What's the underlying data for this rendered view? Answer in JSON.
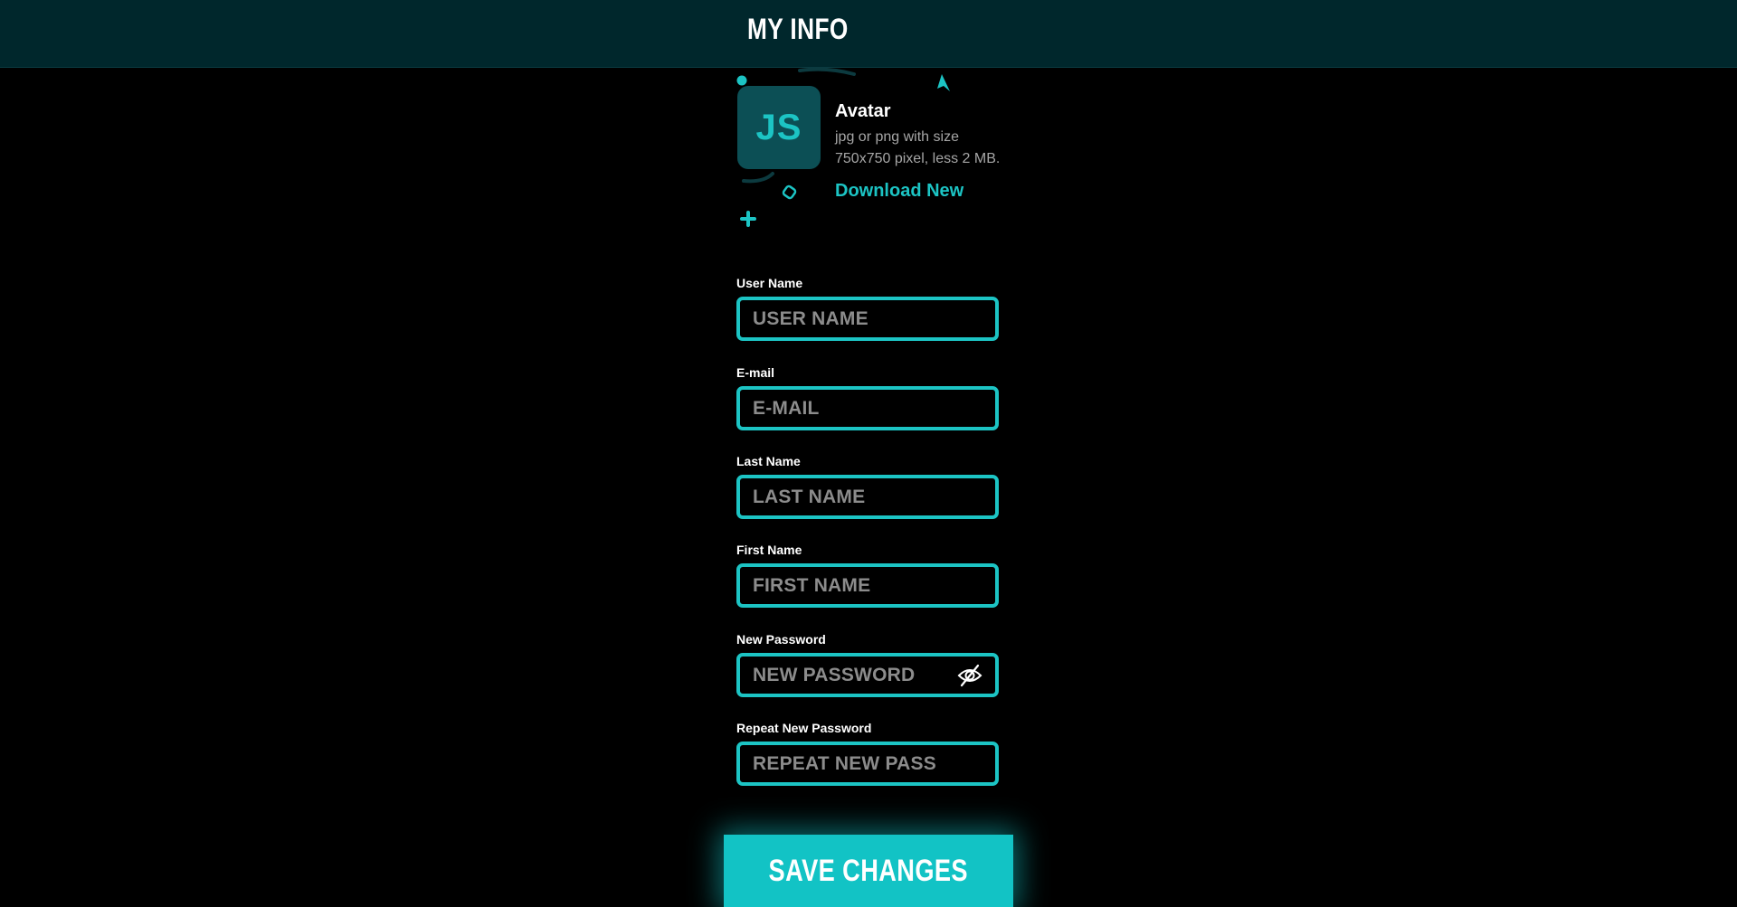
{
  "header": {
    "title": "MY INFO"
  },
  "avatar": {
    "initials": "JS",
    "title": "Avatar",
    "description": "jpg or png with size 750x750 pixel, less 2 MB.",
    "download_label": "Download New"
  },
  "form": {
    "fields": [
      {
        "label": "User Name",
        "placeholder": "USER NAME",
        "type": "text"
      },
      {
        "label": "E-mail",
        "placeholder": "E-MAIL",
        "type": "email"
      },
      {
        "label": "Last Name",
        "placeholder": "LAST NAME",
        "type": "text"
      },
      {
        "label": "First Name",
        "placeholder": "FIRST NAME",
        "type": "text"
      },
      {
        "label": "New Password",
        "placeholder": "NEW PASSWORD",
        "type": "password",
        "icon": "eye-slash-icon"
      },
      {
        "label": "Repeat New Password",
        "placeholder": "REPEAT NEW PASS",
        "type": "password"
      }
    ]
  },
  "actions": {
    "save_label": "SAVE CHANGES"
  },
  "colors": {
    "accent": "#1cc4c4",
    "header_bg": "#00272c",
    "page_bg": "#000000",
    "avatar_bg": "#0c4f55",
    "placeholder": "#8c8c8c"
  }
}
